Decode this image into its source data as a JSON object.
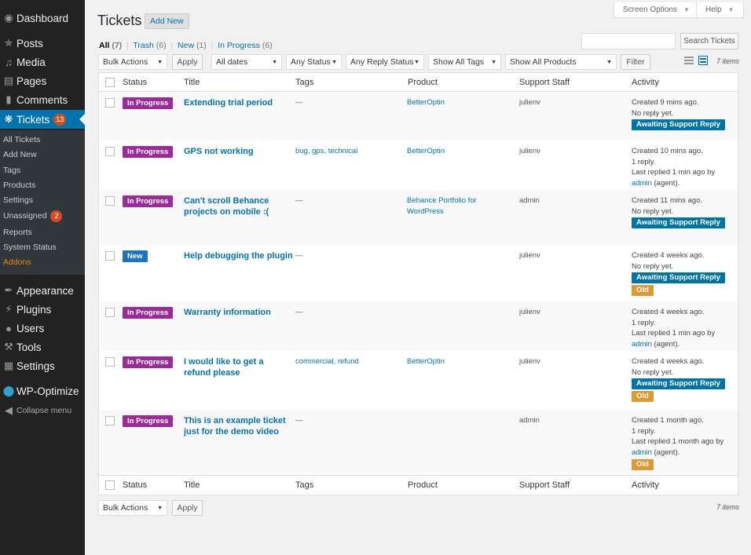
{
  "sidebar": {
    "top_items": [
      {
        "label": "Dashboard",
        "icon": "dashboard-icon"
      },
      {
        "label": "Posts",
        "icon": "pin-icon"
      },
      {
        "label": "Media",
        "icon": "media-icon"
      },
      {
        "label": "Pages",
        "icon": "pages-icon"
      },
      {
        "label": "Comments",
        "icon": "comment-icon"
      }
    ],
    "active_item": {
      "label": "Tickets",
      "count": "13",
      "icon": "ticket-icon"
    },
    "submenu": [
      {
        "label": "All Tickets"
      },
      {
        "label": "Add New"
      },
      {
        "label": "Tags"
      },
      {
        "label": "Products"
      },
      {
        "label": "Settings"
      },
      {
        "label": "Unassigned",
        "count": "2"
      },
      {
        "label": "Reports"
      },
      {
        "label": "System Status"
      },
      {
        "label": "Addons"
      }
    ],
    "bottom_items": [
      {
        "label": "Appearance",
        "icon": "brush-icon"
      },
      {
        "label": "Plugins",
        "icon": "plug-icon"
      },
      {
        "label": "Users",
        "icon": "user-icon"
      },
      {
        "label": "Tools",
        "icon": "wrench-icon"
      },
      {
        "label": "Settings",
        "icon": "settings-icon"
      },
      {
        "label": "WP-Optimize",
        "icon": "wp-optimize-icon"
      }
    ],
    "collapse_label": "Collapse menu"
  },
  "header": {
    "screen_options": "Screen Options",
    "help": "Help",
    "title": "Tickets",
    "add_new": "Add New"
  },
  "filters": {
    "links": [
      {
        "label": "All",
        "count": "(7)"
      },
      {
        "label": "Trash",
        "count": "(6)"
      },
      {
        "label": "New",
        "count": "(1)"
      },
      {
        "label": "In Progress",
        "count": "(6)"
      }
    ],
    "search_button": "Search Tickets",
    "search_value": "",
    "bulk_actions": "Bulk Actions",
    "apply": "Apply",
    "dates": "All dates",
    "status": "Any Status",
    "reply_status": "Any Reply Status",
    "tags": "Show All Tags",
    "products": "Show All Products",
    "filter": "Filter",
    "items_count": "7 items"
  },
  "table": {
    "columns": [
      "Status",
      "Title",
      "Tags",
      "Product",
      "Support Staff",
      "Activity"
    ],
    "rows": [
      {
        "status": "In Progress",
        "status_color": "#9b2a9b",
        "title": "Extending trial period",
        "tags": "—",
        "product": "BetterOptin",
        "staff": "julienv",
        "activity": [
          "Created 9 mins ago.",
          "No reply yet."
        ],
        "reply_badge": "Awaiting Support Reply",
        "old_badge": ""
      },
      {
        "status": "In Progress",
        "status_color": "#9b2a9b",
        "title": "GPS not working",
        "tags": "bug, gps, technical",
        "product": "BetterOptin",
        "staff": "julienv",
        "activity": [
          "Created 10 mins ago.",
          "1 reply.",
          "Last replied 1 min ago by"
        ],
        "agent_link": "admin",
        "agent_suffix": " (agent).",
        "reply_badge": "",
        "old_badge": ""
      },
      {
        "status": "In Progress",
        "status_color": "#9b2a9b",
        "title": "Can't scroll Behance projects on mobile :(",
        "tags": "—",
        "product": "Behance Portfolio for WordPress",
        "staff": "admin",
        "activity": [
          "Created 11 mins ago.",
          "No reply yet."
        ],
        "reply_badge": "Awaiting Support Reply",
        "old_badge": ""
      },
      {
        "status": "New",
        "status_color": "#1e73be",
        "title": "Help debugging the plugin",
        "tags": "—",
        "product": "",
        "staff": "julienv",
        "activity": [
          "Created 4 weeks ago.",
          "No reply yet."
        ],
        "reply_badge": "Awaiting Support Reply",
        "old_badge": "Old"
      },
      {
        "status": "In Progress",
        "status_color": "#9b2a9b",
        "title": "Warranty information",
        "tags": "—",
        "product": "",
        "staff": "julienv",
        "activity": [
          "Created 4 weeks ago.",
          "1 reply.",
          "Last replied 1 min ago by"
        ],
        "agent_link": "admin",
        "agent_suffix": " (agent).",
        "reply_badge": "",
        "old_badge": ""
      },
      {
        "status": "In Progress",
        "status_color": "#9b2a9b",
        "title": "I would like to get a refund please",
        "tags": "commercial, refund",
        "product": "BetterOptin",
        "staff": "julienv",
        "activity": [
          "Created 4 weeks ago.",
          "No reply yet."
        ],
        "reply_badge": "Awaiting Support Reply",
        "old_badge": "Old"
      },
      {
        "status": "In Progress",
        "status_color": "#9b2a9b",
        "title": "This is an example ticket just for the demo video",
        "tags": "—",
        "product": "",
        "staff": "admin",
        "activity": [
          "Created 1 month ago.",
          "1 reply.",
          "Last replied 1 month ago by"
        ],
        "agent_link": "admin",
        "agent_suffix": " (agent).",
        "reply_badge": "",
        "old_badge": "Old"
      }
    ]
  },
  "footer": {
    "bulk_actions": "Bulk Actions",
    "apply": "Apply",
    "items_count": "7 items"
  }
}
